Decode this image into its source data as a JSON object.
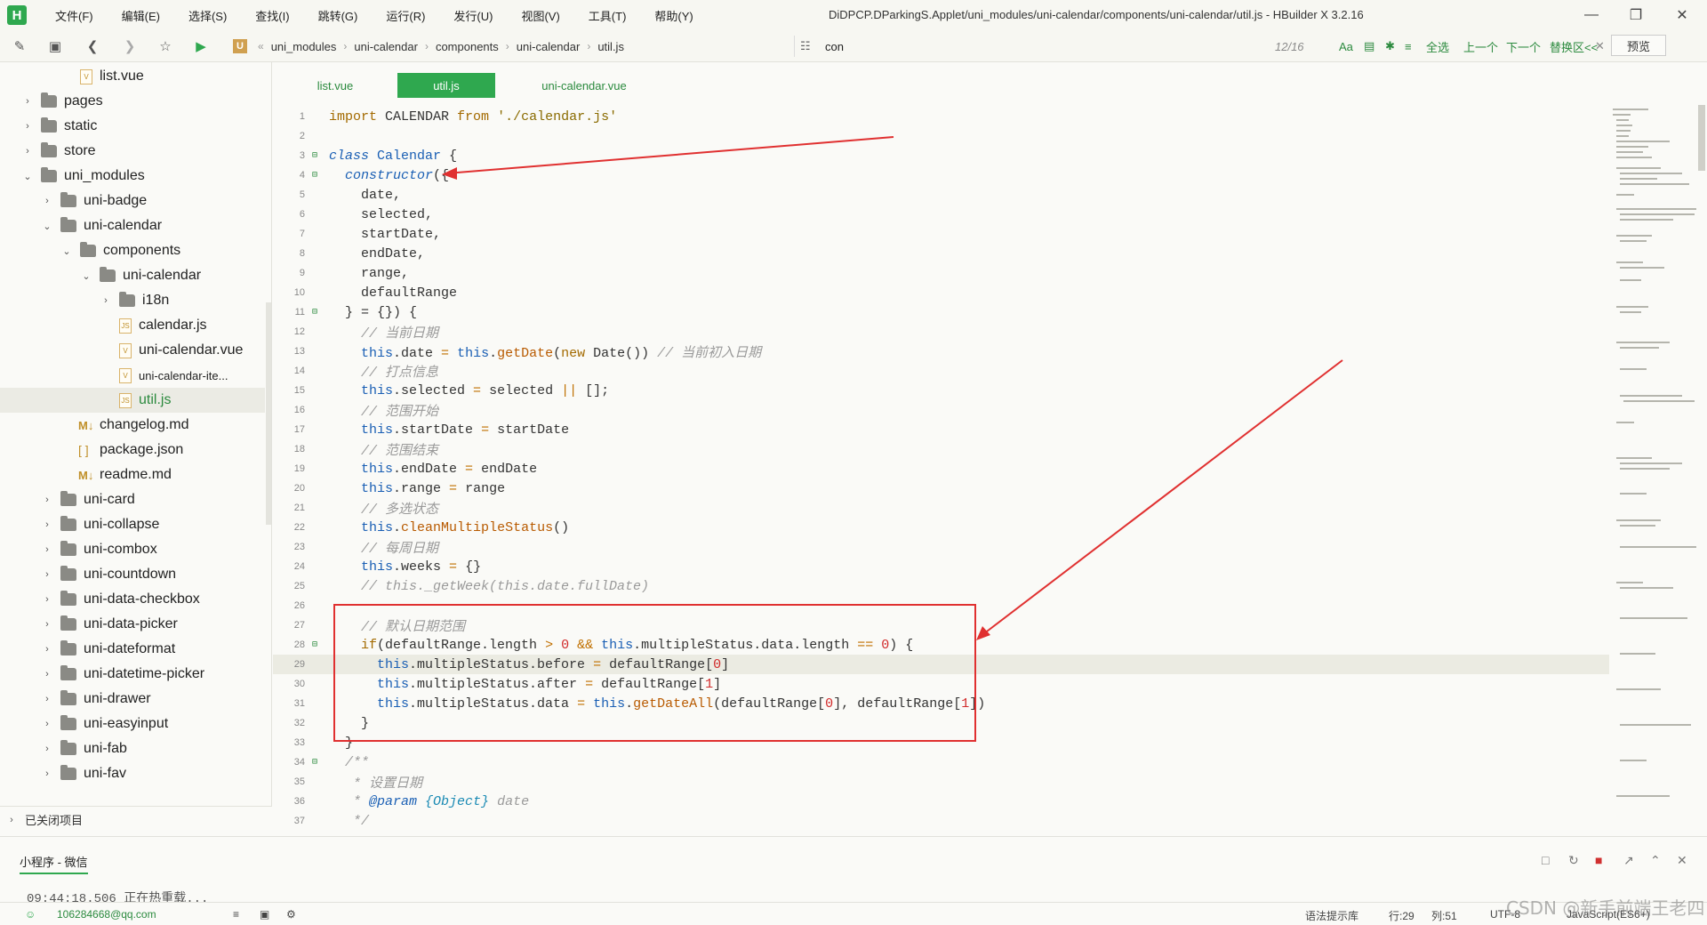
{
  "app": {
    "logo": "H",
    "menus": [
      "文件(F)",
      "编辑(E)",
      "选择(S)",
      "查找(I)",
      "跳转(G)",
      "运行(R)",
      "发行(U)",
      "视图(V)",
      "工具(T)",
      "帮助(Y)"
    ],
    "window_title": "DiDPCP.DParkingS.Applet/uni_modules/uni-calendar/components/uni-calendar/util.js - HBuilder X 3.2.16"
  },
  "toolbar": {
    "breadcrumb_logo": "U",
    "breadcrumb": [
      "uni_modules",
      "uni-calendar",
      "components",
      "uni-calendar",
      "util.js"
    ],
    "search_value": "con",
    "search_count": "12/16",
    "search_opts": [
      "Aa",
      "全选",
      "上一个",
      "下一个",
      "替换区<<"
    ],
    "preview_label": "预览"
  },
  "sidebar": {
    "items": [
      {
        "label": "list.vue",
        "icon": "file"
      },
      {
        "label": "pages",
        "icon": "folder"
      },
      {
        "label": "static",
        "icon": "folder"
      },
      {
        "label": "store",
        "icon": "folder"
      },
      {
        "label": "uni_modules",
        "icon": "folder"
      },
      {
        "label": "uni-badge",
        "icon": "folder"
      },
      {
        "label": "uni-calendar",
        "icon": "folder"
      },
      {
        "label": "components",
        "icon": "folder"
      },
      {
        "label": "uni-calendar",
        "icon": "folder"
      },
      {
        "label": "i18n",
        "icon": "folder"
      },
      {
        "label": "calendar.js",
        "icon": "file"
      },
      {
        "label": "uni-calendar.vue",
        "icon": "file"
      },
      {
        "label": "uni-calendar-ite...",
        "icon": "file"
      },
      {
        "label": "util.js",
        "icon": "file"
      },
      {
        "label": "changelog.md",
        "icon": "md"
      },
      {
        "label": "package.json",
        "icon": "json"
      },
      {
        "label": "readme.md",
        "icon": "md"
      },
      {
        "label": "uni-card",
        "icon": "folder"
      },
      {
        "label": "uni-collapse",
        "icon": "folder"
      },
      {
        "label": "uni-combox",
        "icon": "folder"
      },
      {
        "label": "uni-countdown",
        "icon": "folder"
      },
      {
        "label": "uni-data-checkbox",
        "icon": "folder"
      },
      {
        "label": "uni-data-picker",
        "icon": "folder"
      },
      {
        "label": "uni-dateformat",
        "icon": "folder"
      },
      {
        "label": "uni-datetime-picker",
        "icon": "folder"
      },
      {
        "label": "uni-drawer",
        "icon": "folder"
      },
      {
        "label": "uni-easyinput",
        "icon": "folder"
      },
      {
        "label": "uni-fab",
        "icon": "folder"
      },
      {
        "label": "uni-fav",
        "icon": "folder"
      }
    ],
    "closed_projects": "已关闭项目"
  },
  "tabs": [
    "list.vue",
    "util.js",
    "uni-calendar.vue"
  ],
  "editor": {
    "line_numbers": [
      "1",
      "2",
      "3",
      "4",
      "5",
      "6",
      "7",
      "8",
      "9",
      "10",
      "11",
      "12",
      "13",
      "14",
      "15",
      "16",
      "17",
      "18",
      "19",
      "20",
      "21",
      "22",
      "23",
      "24",
      "25",
      "26",
      "27",
      "28",
      "29",
      "30",
      "31",
      "32",
      "33",
      "34",
      "35",
      "36",
      "37"
    ],
    "lines": [
      "import CALENDAR from './calendar.js'",
      "",
      "class Calendar {",
      "  constructor({",
      "    date,",
      "    selected,",
      "    startDate,",
      "    endDate,",
      "    range,",
      "    defaultRange",
      "  } = {}) {",
      "    // 当前日期",
      "    this.date = this.getDate(new Date()) // 当前初入日期",
      "    // 打点信息",
      "    this.selected = selected || [];",
      "    // 范围开始",
      "    this.startDate = startDate",
      "    // 范围结束",
      "    this.endDate = endDate",
      "    this.range = range",
      "    // 多选状态",
      "    this.cleanMultipleStatus()",
      "    // 每周日期",
      "    this.weeks = {}",
      "    // this._getWeek(this.date.fullDate)",
      "",
      "    // 默认日期范围",
      "    if(defaultRange.length > 0 && this.multipleStatus.data.length == 0) {",
      "      this.multipleStatus.before = defaultRange[0]",
      "      this.multipleStatus.after = defaultRange[1]",
      "      this.multipleStatus.data = this.getDateAll(defaultRange[0], defaultRange[1])",
      "    }",
      "  }",
      "  /**",
      "   * 设置日期",
      "   * @param {Object} date",
      "   */"
    ]
  },
  "console": {
    "tab": "小程序 - 微信",
    "log": "09:44:18.506 正在热重载..."
  },
  "status": {
    "user": "106284668@qq.com",
    "hint": "语法提示库",
    "row": "行:29",
    "col": "列:51",
    "encoding": "UTF-8",
    "language": "JavaScript(ES6+)"
  },
  "watermark": "CSDN @新手前端王老四",
  "colors": {
    "accent": "#2fa84f",
    "annotation": "#e03030"
  }
}
